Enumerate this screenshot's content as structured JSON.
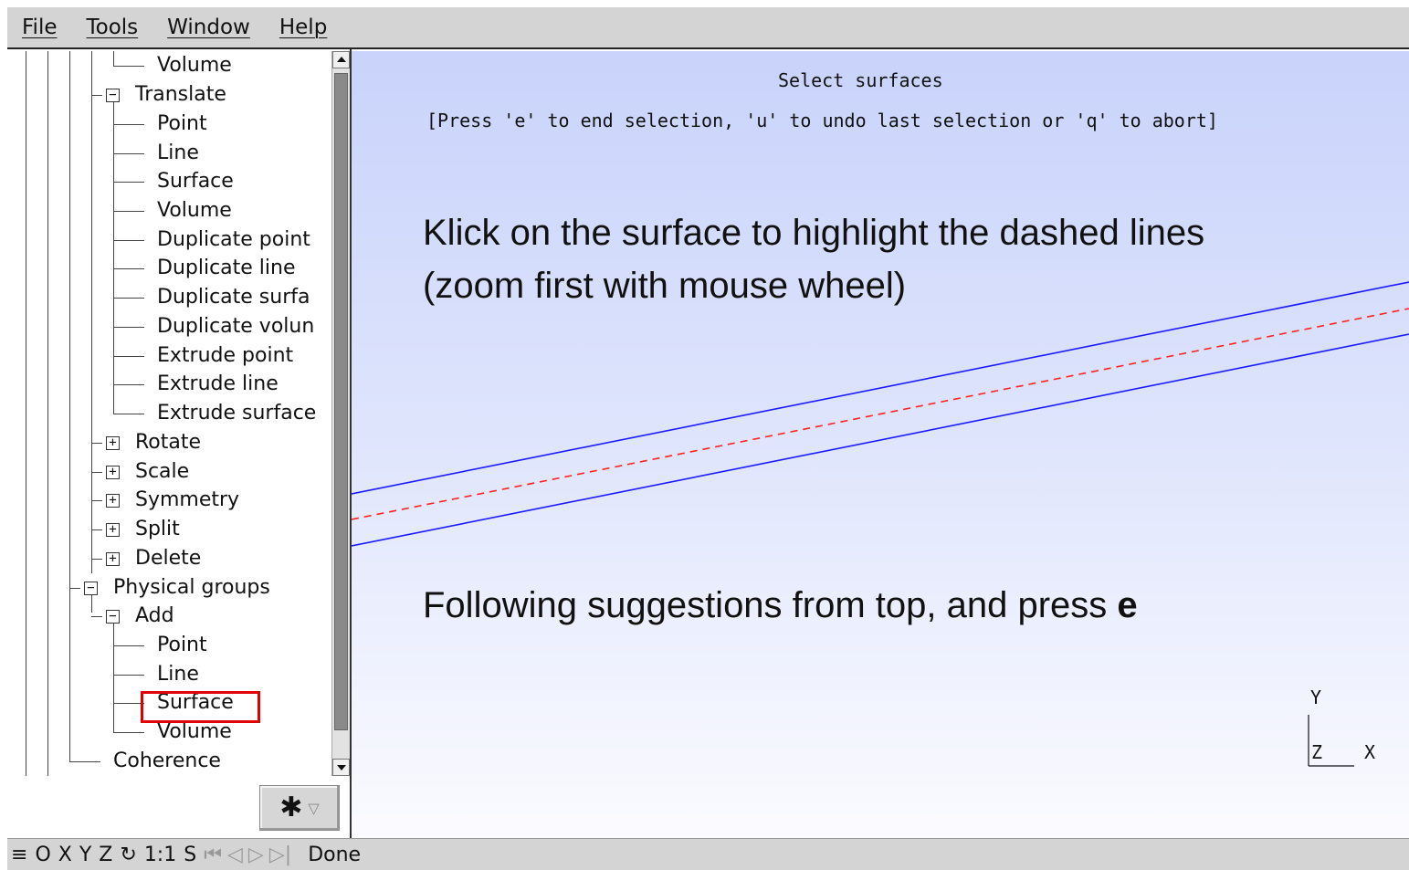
{
  "menubar": {
    "items": [
      "File",
      "Tools",
      "Window",
      "Help"
    ]
  },
  "tree": {
    "nodes": [
      {
        "label": "Volume",
        "toggle": ""
      },
      {
        "label": "Translate",
        "toggle": "−"
      },
      {
        "label": "Point",
        "toggle": ""
      },
      {
        "label": "Line",
        "toggle": ""
      },
      {
        "label": "Surface",
        "toggle": ""
      },
      {
        "label": "Volume",
        "toggle": ""
      },
      {
        "label": "Duplicate point",
        "toggle": ""
      },
      {
        "label": "Duplicate line",
        "toggle": ""
      },
      {
        "label": "Duplicate surfa",
        "toggle": ""
      },
      {
        "label": "Duplicate volun",
        "toggle": ""
      },
      {
        "label": "Extrude point",
        "toggle": ""
      },
      {
        "label": "Extrude line",
        "toggle": ""
      },
      {
        "label": "Extrude surface",
        "toggle": ""
      },
      {
        "label": "Rotate",
        "toggle": "+"
      },
      {
        "label": "Scale",
        "toggle": "+"
      },
      {
        "label": "Symmetry",
        "toggle": "+"
      },
      {
        "label": "Split",
        "toggle": "+"
      },
      {
        "label": "Delete",
        "toggle": "+"
      },
      {
        "label": "Physical groups",
        "toggle": "−"
      },
      {
        "label": "Add",
        "toggle": "−"
      },
      {
        "label": "Point",
        "toggle": ""
      },
      {
        "label": "Line",
        "toggle": ""
      },
      {
        "label": "Surface",
        "toggle": ""
      },
      {
        "label": "Volume",
        "toggle": ""
      },
      {
        "label": "Coherence",
        "toggle": ""
      }
    ]
  },
  "gear_button": {
    "icon": "gear-icon",
    "arrow": "▽"
  },
  "graphics": {
    "prompt_title": "Select surfaces",
    "prompt_hint": "[Press 'e' to end selection, 'u' to undo last selection or 'q' to abort]",
    "annotation_1": "Klick on the surface to highlight the dashed lines (zoom first with mouse wheel)",
    "annotation_2_text": "Following suggestions  from top, and press ",
    "annotation_2_key": "e",
    "axes": {
      "y": "Y",
      "z": "Z",
      "x": "X"
    },
    "colors": {
      "solid_line": "#1a1aff",
      "dashed_line": "#ff2020",
      "highlight": "#e00000"
    }
  },
  "statusbar": {
    "menu_icon": "≡",
    "o": "O",
    "x": "X",
    "y": "Y",
    "z": "Z",
    "rotate_icon": "↻",
    "scale": "1:1",
    "s": "S",
    "first_icon": "⏮",
    "prev_icon": "◁",
    "play_icon": "▷",
    "next_icon": "▷|",
    "status": "Done"
  }
}
